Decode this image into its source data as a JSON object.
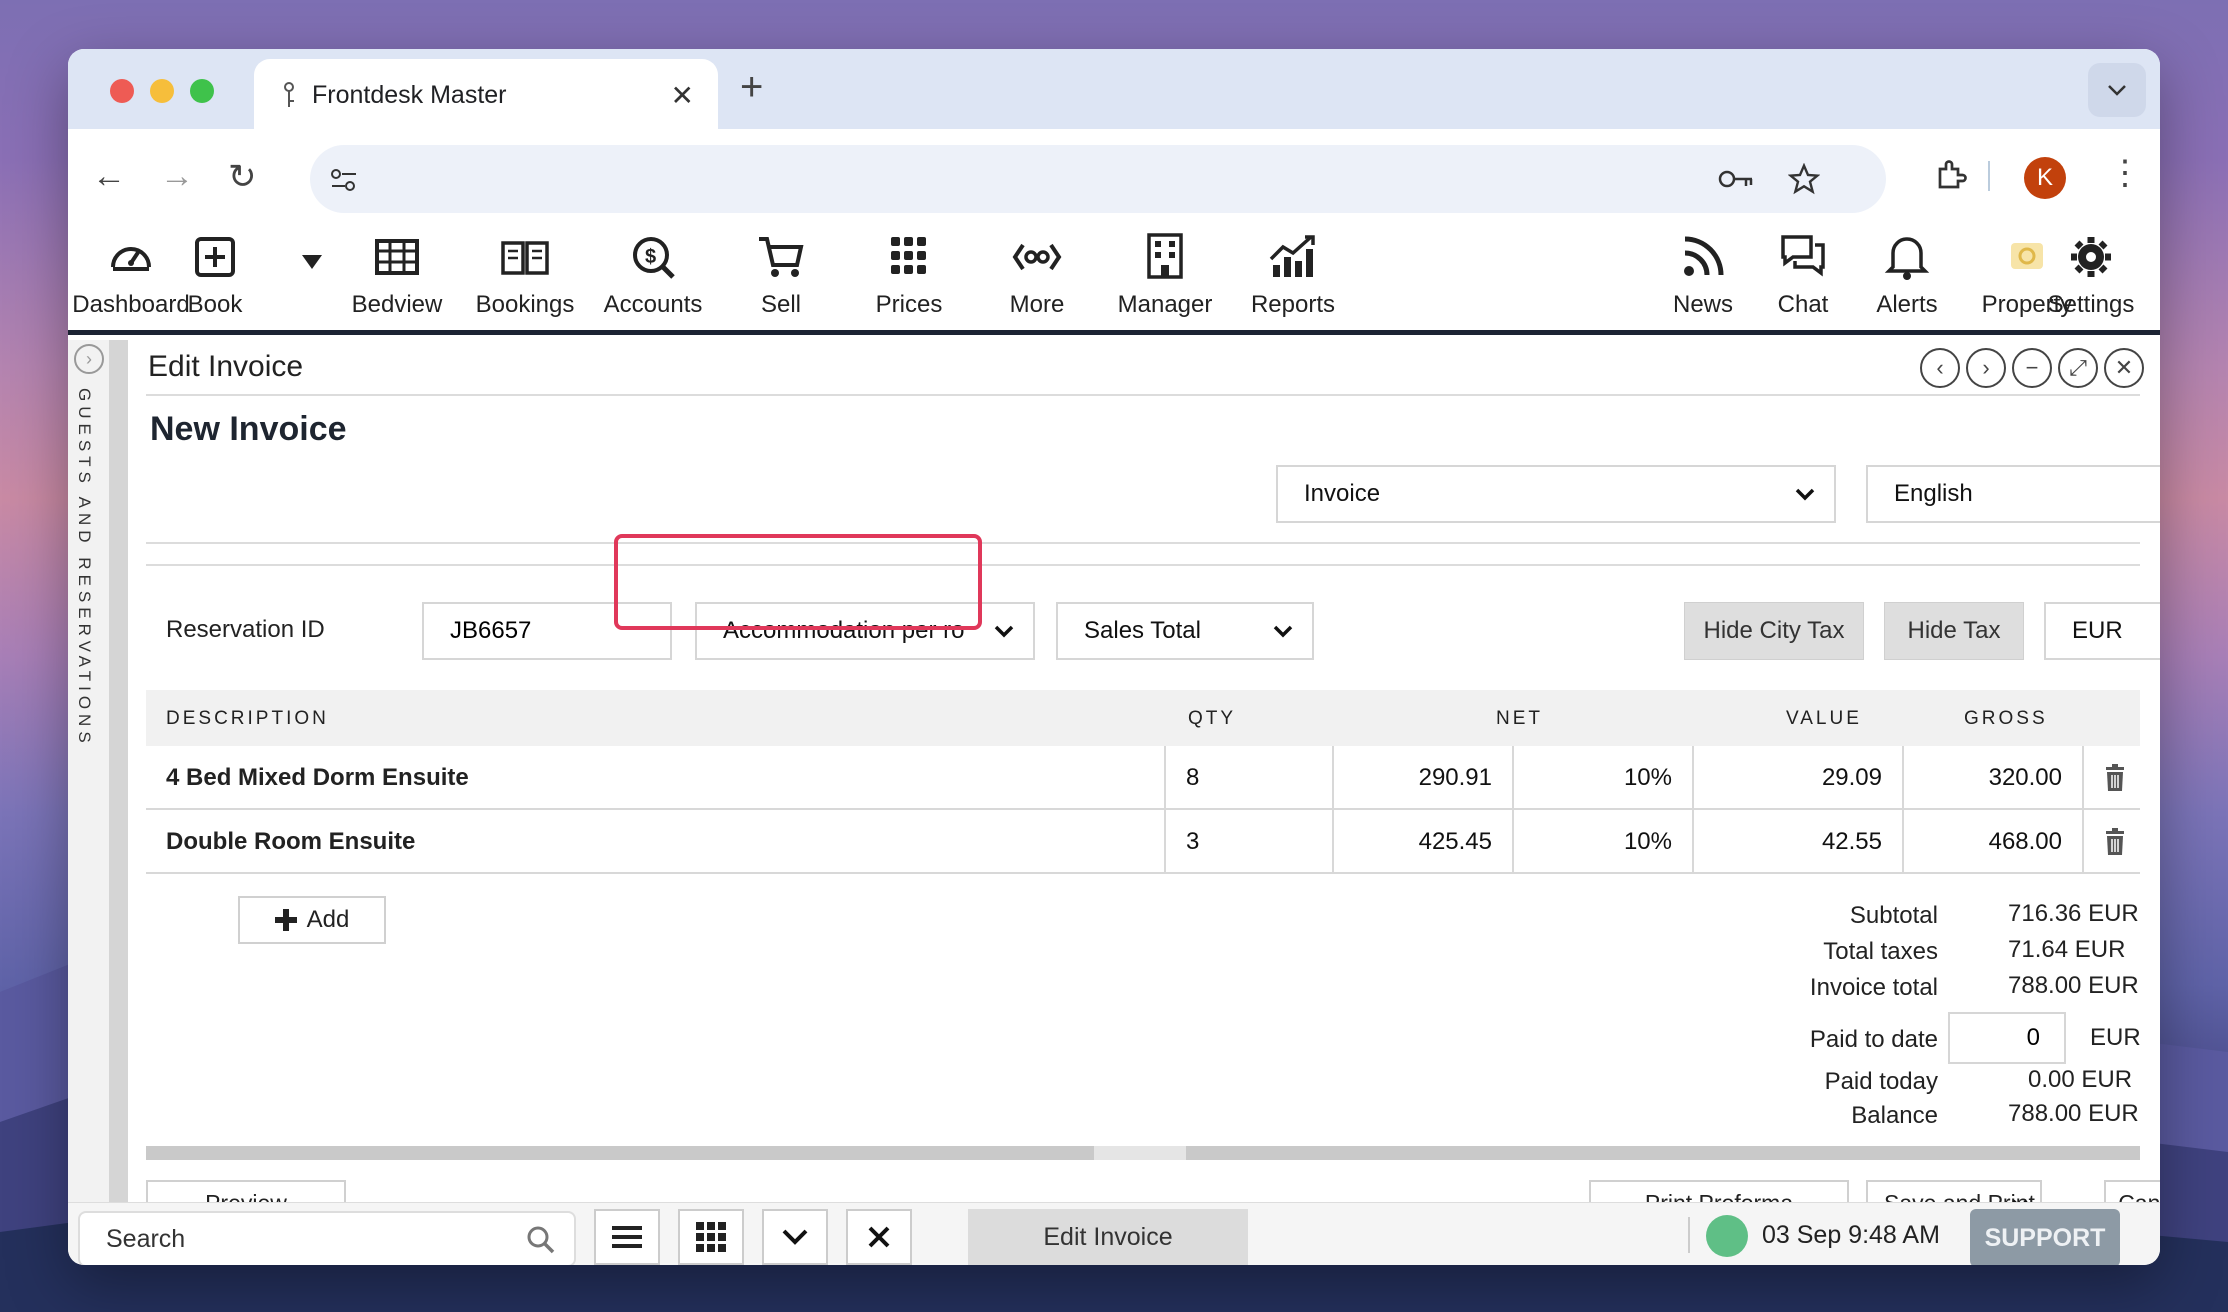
{
  "browser": {
    "tab_title": "Frontdesk Master",
    "profile_initial": "K"
  },
  "menu": [
    {
      "label": "Dashboard",
      "icon": "dashboard-icon"
    },
    {
      "label": "Book",
      "icon": "book-icon"
    },
    {
      "label": "Bedview",
      "icon": "bedview-icon"
    },
    {
      "label": "Bookings",
      "icon": "bookings-icon"
    },
    {
      "label": "Accounts",
      "icon": "accounts-icon"
    },
    {
      "label": "Sell",
      "icon": "cart-icon"
    },
    {
      "label": "Prices",
      "icon": "prices-icon"
    },
    {
      "label": "More",
      "icon": "more-icon"
    },
    {
      "label": "Manager",
      "icon": "manager-icon"
    },
    {
      "label": "Reports",
      "icon": "reports-icon"
    },
    {
      "label": "News",
      "icon": "rss-icon"
    },
    {
      "label": "Chat",
      "icon": "chat-icon"
    },
    {
      "label": "Alerts",
      "icon": "bell-icon"
    },
    {
      "label": "Property",
      "icon": "property-icon"
    },
    {
      "label": "Settings",
      "icon": "gear-icon"
    }
  ],
  "sidebar": {
    "label": "GUESTS AND RESERVATIONS"
  },
  "panel": {
    "title": "Edit Invoice",
    "heading": "New Invoice",
    "doc_type": "Invoice",
    "language": "English"
  },
  "filters": {
    "reservation_label": "Reservation ID",
    "reservation_value": "JB6657",
    "accommodation": "Accommodation per rο",
    "sales": "Sales Total",
    "hide_city_tax": "Hide City Tax",
    "hide_tax": "Hide Tax",
    "currency": "EUR"
  },
  "table": {
    "headers": {
      "description": "DESCRIPTION",
      "qty": "QTY",
      "net": "NET",
      "value": "VALUE",
      "gross": "GROSS"
    },
    "rows": [
      {
        "description": "4 Bed Mixed Dorm Ensuite",
        "qty": "8",
        "net": "290.91",
        "tax": "10%",
        "value": "29.09",
        "gross": "320.00"
      },
      {
        "description": "Double Room Ensuite",
        "qty": "3",
        "net": "425.45",
        "tax": "10%",
        "value": "42.55",
        "gross": "468.00"
      }
    ]
  },
  "add_label": "Add",
  "totals": {
    "subtotal_label": "Subtotal",
    "subtotal": "716.36 EUR",
    "taxes_label": "Total taxes",
    "taxes": "71.64 EUR",
    "invoice_total_label": "Invoice total",
    "invoice_total": "788.00 EUR",
    "paid_label": "Paid to date",
    "paid_value": "0",
    "paid_currency": "EUR",
    "paid_today_label": "Paid today",
    "paid_today": "0.00 EUR",
    "balance_label": "Balance",
    "balance": "788.00 EUR"
  },
  "actions": {
    "preview": "Preview",
    "print_proforma": "Print Proforma",
    "save_print": "Save and Print",
    "cancel": "Cancel"
  },
  "bottom": {
    "search_placeholder": "Search",
    "edit_invoice": "Edit Invoice",
    "datetime": "03 Sep 9:48 AM",
    "support": "SUPPORT"
  }
}
